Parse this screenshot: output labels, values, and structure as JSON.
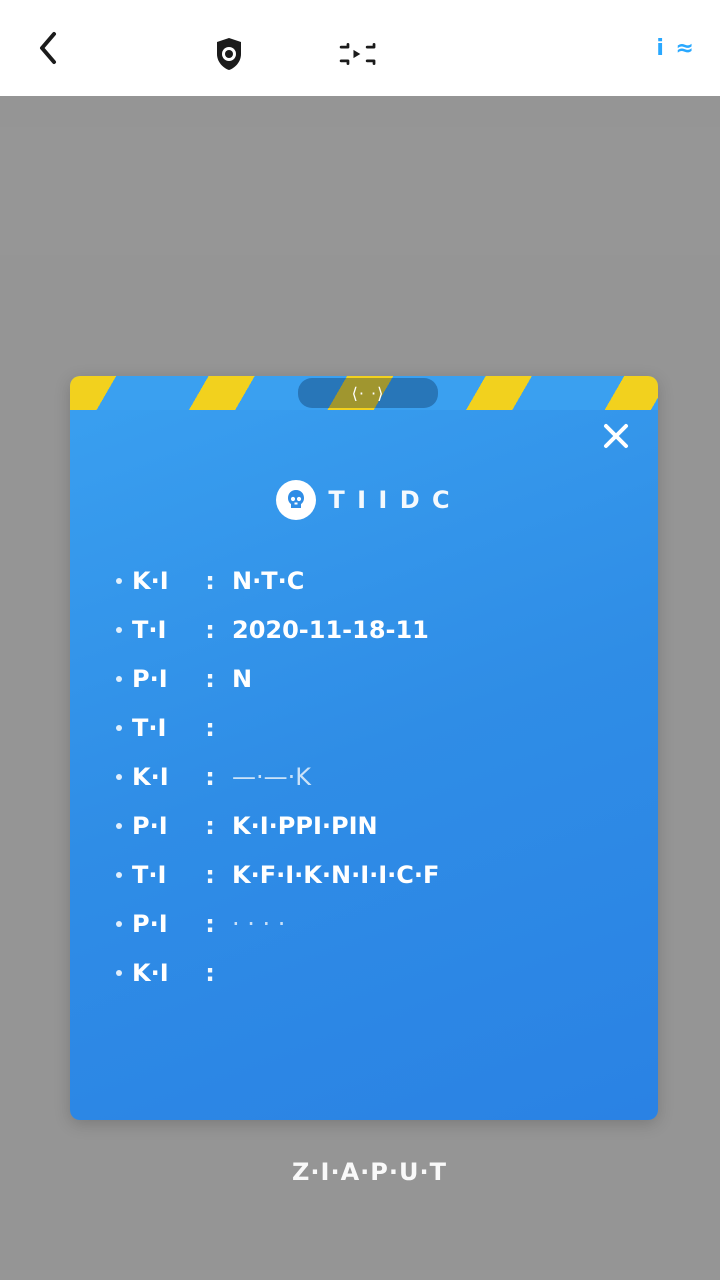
{
  "header": {
    "back_icon": "chevron-left-icon",
    "left_center_icon": "badge-icon",
    "right_center_icon": "scan-icon",
    "right_label": "i ≈"
  },
  "modal": {
    "stripe_badge": "⟨· ·⟩",
    "close_icon": "close-icon",
    "title_icon": "skull-icon",
    "title": "T I I D C",
    "rows": [
      {
        "label": "K·I",
        "value": "N·T·C"
      },
      {
        "label": "T·I",
        "value": "2020-11-18-11"
      },
      {
        "label": "P·I",
        "value": "N"
      },
      {
        "label": "T·I",
        "value": ""
      },
      {
        "label": "K·I",
        "value": "—·—·K"
      },
      {
        "label": "P·I",
        "value": "K·I·PPI·PIN"
      },
      {
        "label": "T·I",
        "value": "K·F·I·K·N·I·I·C·F"
      },
      {
        "label": "P·I",
        "value": "· · · ·"
      },
      {
        "label": "K·I",
        "value": ""
      }
    ]
  },
  "footer": {
    "link": "Z·I·A·P·U·T"
  }
}
